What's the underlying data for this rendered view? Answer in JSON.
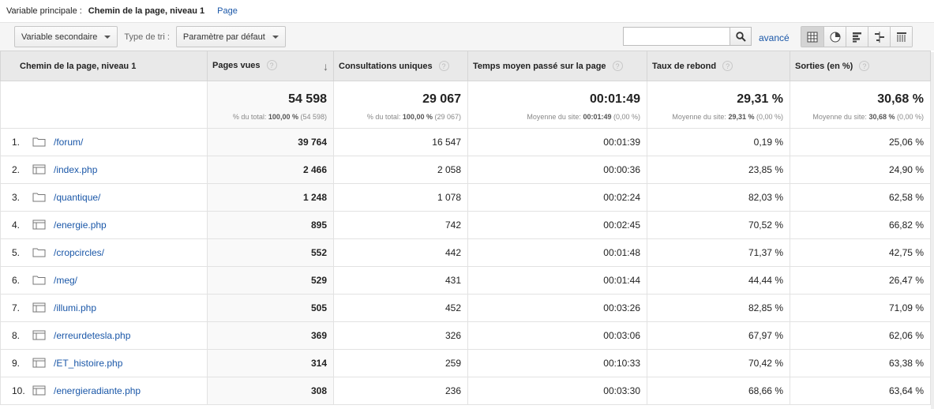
{
  "topbar": {
    "primary_label": "Variable principale :",
    "primary_value": "Chemin de la page, niveau 1",
    "page_link": "Page"
  },
  "toolbar": {
    "secondary_dim": "Variable secondaire",
    "sort_label": "Type de tri :",
    "sort_value": "Paramètre par défaut",
    "search_value": "",
    "search_icon": "search-icon",
    "advanced": "avancé",
    "view_icons": [
      "table-icon",
      "pie-icon",
      "performance-icon",
      "comparison-icon",
      "pivot-icon"
    ]
  },
  "columns": [
    {
      "label": "Chemin de la page, niveau 1"
    },
    {
      "label": "Pages vues",
      "sorted": "desc",
      "sort_glyph": "↓"
    },
    {
      "label": "Consultations uniques"
    },
    {
      "label": "Temps moyen passé sur la page"
    },
    {
      "label": "Taux de rebond"
    },
    {
      "label": "Sorties (en %)"
    }
  ],
  "help_glyph": "?",
  "totals": [
    {
      "value": "54 598",
      "prefix": "% du total:",
      "bold": "100,00 %",
      "paren": "(54 598)"
    },
    {
      "value": "29 067",
      "prefix": "% du total:",
      "bold": "100,00 %",
      "paren": "(29 067)"
    },
    {
      "value": "00:01:49",
      "prefix": "Moyenne du site:",
      "bold": "00:01:49",
      "paren": "(0,00 %)"
    },
    {
      "value": "29,31 %",
      "prefix": "Moyenne du site:",
      "bold": "29,31 %",
      "paren": "(0,00 %)"
    },
    {
      "value": "30,68 %",
      "prefix": "Moyenne du site:",
      "bold": "30,68 %",
      "paren": "(0,00 %)"
    }
  ],
  "rows": [
    {
      "num": "1.",
      "icon": "folder-icon",
      "path": "/forum/",
      "pv": "39 764",
      "uv": "16 547",
      "time": "00:01:39",
      "bounce": "0,19 %",
      "exit": "25,06 %"
    },
    {
      "num": "2.",
      "icon": "page-icon",
      "path": "/index.php",
      "pv": "2 466",
      "uv": "2 058",
      "time": "00:00:36",
      "bounce": "23,85 %",
      "exit": "24,90 %"
    },
    {
      "num": "3.",
      "icon": "folder-icon",
      "path": "/quantique/",
      "pv": "1 248",
      "uv": "1 078",
      "time": "00:02:24",
      "bounce": "82,03 %",
      "exit": "62,58 %"
    },
    {
      "num": "4.",
      "icon": "page-icon",
      "path": "/energie.php",
      "pv": "895",
      "uv": "742",
      "time": "00:02:45",
      "bounce": "70,52 %",
      "exit": "66,82 %"
    },
    {
      "num": "5.",
      "icon": "folder-icon",
      "path": "/cropcircles/",
      "pv": "552",
      "uv": "442",
      "time": "00:01:48",
      "bounce": "71,37 %",
      "exit": "42,75 %"
    },
    {
      "num": "6.",
      "icon": "folder-icon",
      "path": "/meg/",
      "pv": "529",
      "uv": "431",
      "time": "00:01:44",
      "bounce": "44,44 %",
      "exit": "26,47 %"
    },
    {
      "num": "7.",
      "icon": "page-icon",
      "path": "/illumi.php",
      "pv": "505",
      "uv": "452",
      "time": "00:03:26",
      "bounce": "82,85 %",
      "exit": "71,09 %"
    },
    {
      "num": "8.",
      "icon": "page-icon",
      "path": "/erreurdetesla.php",
      "pv": "369",
      "uv": "326",
      "time": "00:03:06",
      "bounce": "67,97 %",
      "exit": "62,06 %"
    },
    {
      "num": "9.",
      "icon": "page-icon",
      "path": "/ET_histoire.php",
      "pv": "314",
      "uv": "259",
      "time": "00:10:33",
      "bounce": "70,42 %",
      "exit": "63,38 %"
    },
    {
      "num": "10.",
      "icon": "page-icon",
      "path": "/energieradiante.php",
      "pv": "308",
      "uv": "236",
      "time": "00:03:30",
      "bounce": "68,66 %",
      "exit": "63,64 %"
    }
  ]
}
